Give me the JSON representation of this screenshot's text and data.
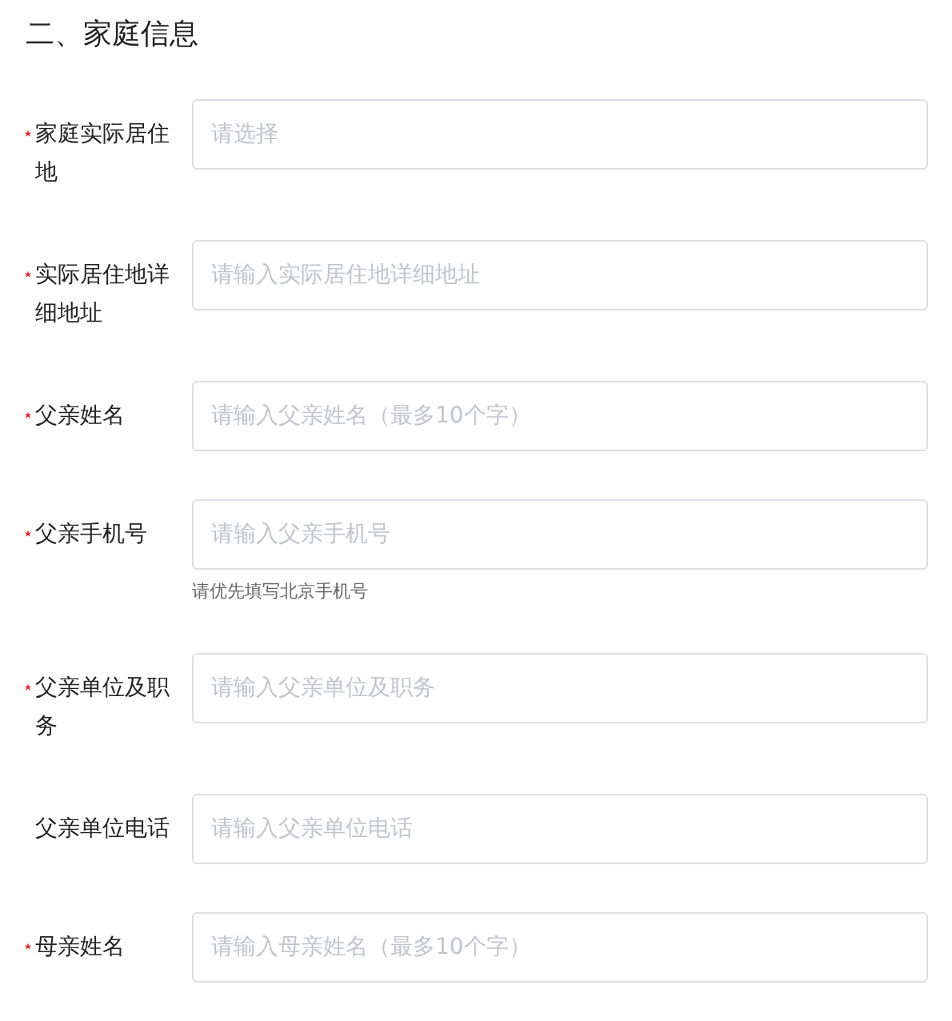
{
  "section_title": "二、家庭信息",
  "fields": [
    {
      "label": "家庭实际居住地",
      "required": true,
      "placeholder": "请选择"
    },
    {
      "label": "实际居住地详细地址",
      "required": true,
      "placeholder": "请输入实际居住地详细地址"
    },
    {
      "label": "父亲姓名",
      "required": true,
      "placeholder": "请输入父亲姓名（最多10个字）"
    },
    {
      "label": "父亲手机号",
      "required": true,
      "placeholder": "请输入父亲手机号",
      "hint": "请优先填写北京手机号"
    },
    {
      "label": "父亲单位及职务",
      "required": true,
      "placeholder": "请输入父亲单位及职务"
    },
    {
      "label": "父亲单位电话",
      "required": false,
      "placeholder": "请输入父亲单位电话"
    },
    {
      "label": "母亲姓名",
      "required": true,
      "placeholder": "请输入母亲姓名（最多10个字）"
    }
  ]
}
